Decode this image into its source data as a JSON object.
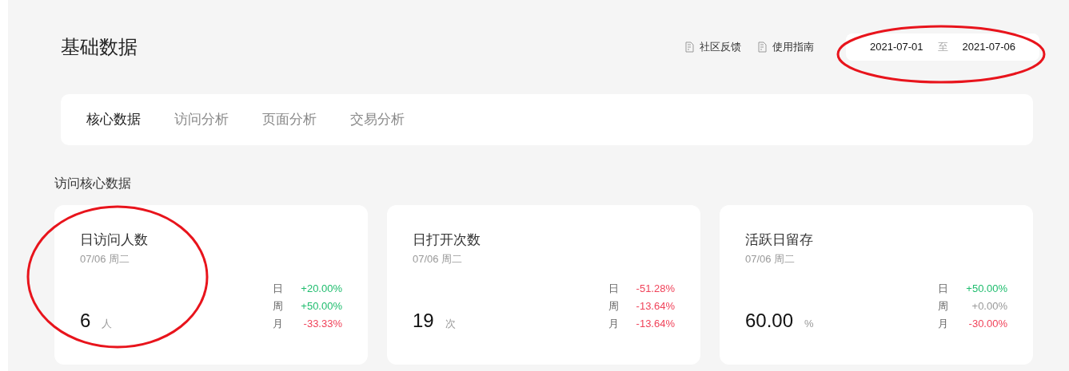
{
  "page_title": "基础数据",
  "header_links": [
    {
      "label": "社区反馈"
    },
    {
      "label": "使用指南"
    }
  ],
  "date_range": {
    "start": "2021-07-01",
    "separator": "至",
    "end": "2021-07-06"
  },
  "tabs": [
    {
      "label": "核心数据",
      "selected": true
    },
    {
      "label": "访问分析",
      "selected": false
    },
    {
      "label": "页面分析",
      "selected": false
    },
    {
      "label": "交易分析",
      "selected": false
    }
  ],
  "section_title": "访问核心数据",
  "cards": [
    {
      "title": "日访问人数",
      "date": "07/06 周二",
      "value": "6",
      "unit": "人",
      "changes": [
        {
          "period": "日",
          "value": "+20.00%",
          "color": "#1fbd6e"
        },
        {
          "period": "周",
          "value": "+50.00%",
          "color": "#1fbd6e"
        },
        {
          "period": "月",
          "value": "-33.33%",
          "color": "#f0435a"
        }
      ]
    },
    {
      "title": "日打开次数",
      "date": "07/06 周二",
      "value": "19",
      "unit": "次",
      "changes": [
        {
          "period": "日",
          "value": "-51.28%",
          "color": "#f0435a"
        },
        {
          "period": "周",
          "value": "-13.64%",
          "color": "#f0435a"
        },
        {
          "period": "月",
          "value": "-13.64%",
          "color": "#f0435a"
        }
      ]
    },
    {
      "title": "活跃日留存",
      "date": "07/06 周二",
      "value": "60.00",
      "unit": "%",
      "changes": [
        {
          "period": "日",
          "value": "+50.00%",
          "color": "#1fbd6e"
        },
        {
          "period": "周",
          "value": "+0.00%",
          "color": "#999999"
        },
        {
          "period": "月",
          "value": "-30.00%",
          "color": "#f0435a"
        }
      ]
    }
  ]
}
